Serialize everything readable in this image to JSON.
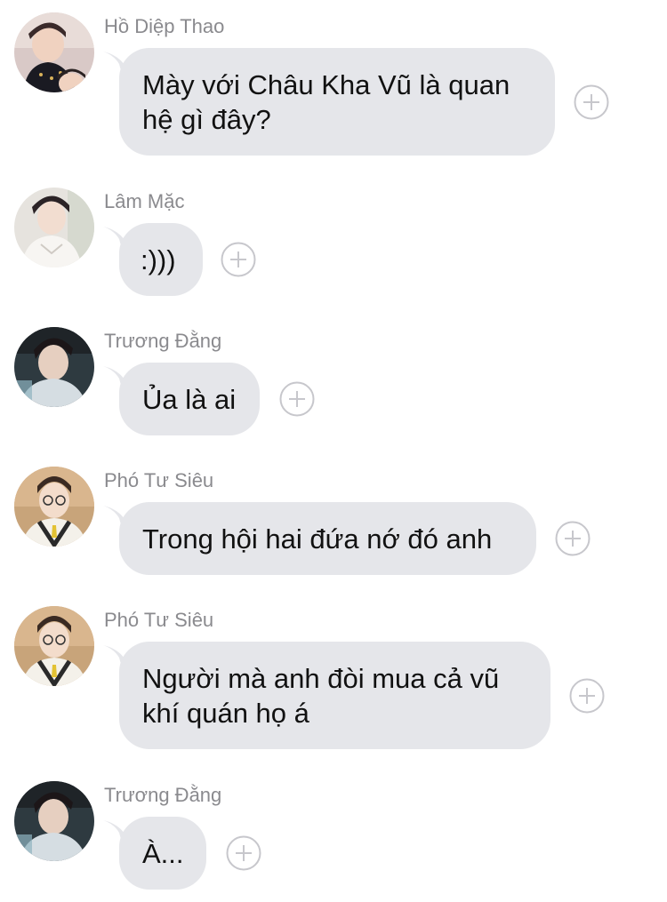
{
  "colors": {
    "bubble": "#e5e6ea",
    "sender": "#8a8a8e",
    "text": "#111111",
    "react_icon": "#c7c7cc"
  },
  "messages": [
    {
      "sender": "Hồ Diệp Thao",
      "text_lines": [
        "Mày với Châu Kha Vũ là quan",
        "hệ gì đây?"
      ],
      "avatar": "avatar-ho-diep-thao",
      "react_icon": "add-reaction-icon"
    },
    {
      "sender": "Lâm Mặc",
      "text_lines": [
        ":)))"
      ],
      "avatar": "avatar-lam-mac",
      "react_icon": "add-reaction-icon"
    },
    {
      "sender": "Trương Đằng",
      "text_lines": [
        "Ủa là ai"
      ],
      "avatar": "avatar-truong-dang",
      "react_icon": "add-reaction-icon"
    },
    {
      "sender": "Phó Tư Siêu",
      "text_lines": [
        "Trong hội hai đứa nớ đó anh"
      ],
      "avatar": "avatar-pho-tu-sieu",
      "react_icon": "add-reaction-icon"
    },
    {
      "sender": "Phó Tư Siêu",
      "text_lines": [
        "Người mà anh đòi mua cả vũ",
        "khí quán họ á"
      ],
      "avatar": "avatar-pho-tu-sieu",
      "react_icon": "add-reaction-icon"
    },
    {
      "sender": "Trương Đằng",
      "text_lines": [
        "À..."
      ],
      "avatar": "avatar-truong-dang",
      "react_icon": "add-reaction-icon"
    }
  ]
}
